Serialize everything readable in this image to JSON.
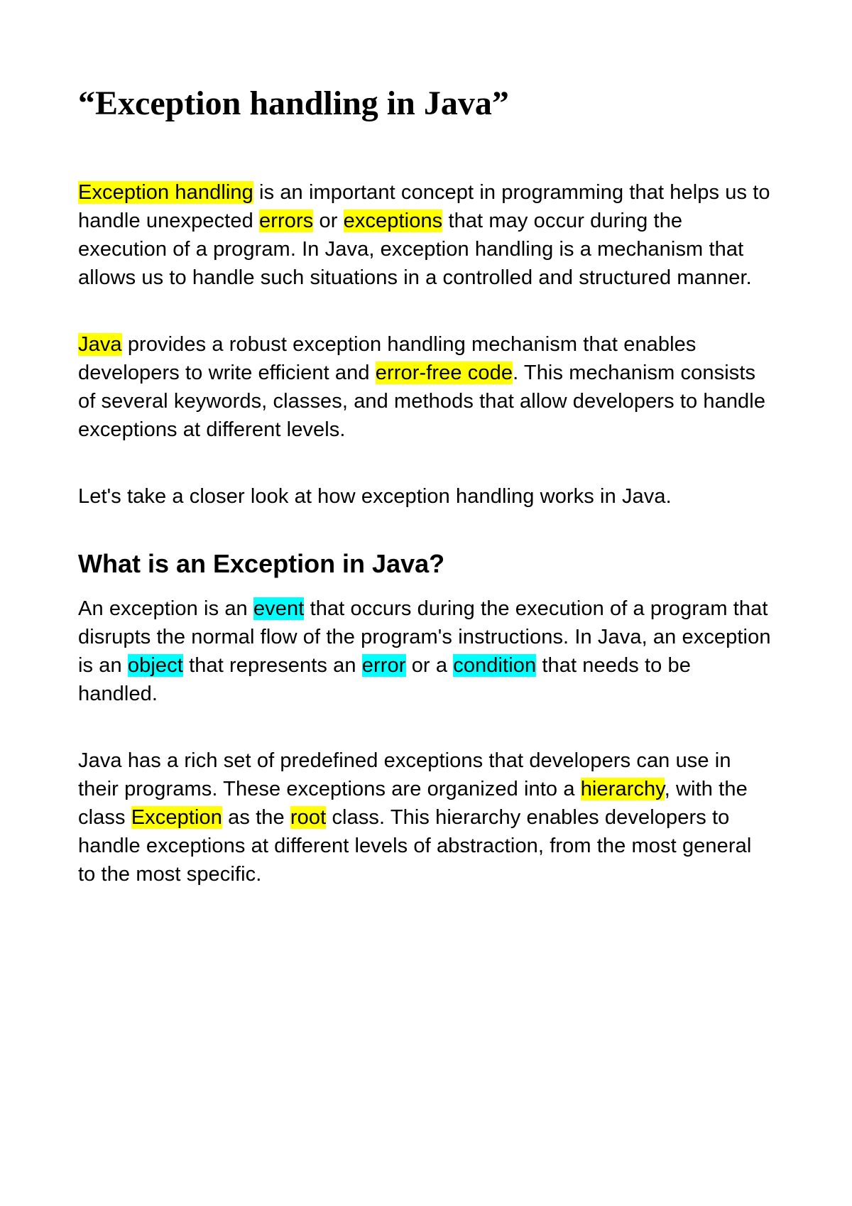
{
  "title": "“Exception handling in Java”",
  "para1": {
    "s1_hl": "Exception handling",
    "s1_rest": " is an important concept in programming that helps us to handle unexpected ",
    "s2_hl": "errors",
    "s3": " or ",
    "s4_hl": "exceptions",
    "s5": " that may occur during the execution of a program. In Java, exception handling is a mechanism that allows us to handle such situations in a controlled and structured manner."
  },
  "para2": {
    "s1_hl": "Java",
    "s2": " provides a robust exception handling mechanism that enables developers to write efficient and ",
    "s3_hl": "error-free code",
    "s4": ". This mechanism consists of several keywords, classes, and methods that allow developers to handle exceptions at different levels."
  },
  "para3": "Let's take a closer look at how exception handling works in Java.",
  "subheading1": "What is an Exception in Java?",
  "para4": {
    "s1": "An exception is an ",
    "s2_hl": "event",
    "s3": " that occurs during the execution of a program that disrupts the normal flow of the program's instructions. In Java, an exception is an ",
    "s4_hl": "object",
    "s5": " that represents an ",
    "s6_hl": "error",
    "s7": " or a ",
    "s8_hl": "condition",
    "s9": " that needs to be handled."
  },
  "para5": {
    "s1": "Java has a rich set of predefined exceptions that developers can use in their programs. These exceptions are organized into a ",
    "s2_hl": "hierarchy",
    "s3": ", with the class ",
    "s4_hl": "Exception",
    "s5": " as the ",
    "s6_hl": "root",
    "s7": " class. This hierarchy enables developers to handle exceptions at different levels of abstraction, from the most general to the most specific."
  }
}
